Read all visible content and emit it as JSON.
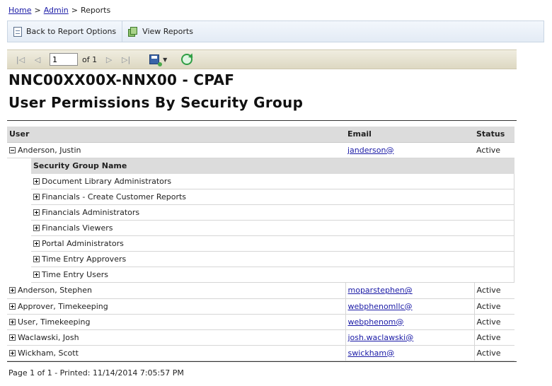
{
  "breadcrumb": {
    "home": "Home",
    "admin": "Admin",
    "current": "Reports",
    "separator": ">"
  },
  "actionbar": {
    "back_label": "Back to Report Options",
    "view_label": "View Reports"
  },
  "viewer_toolbar": {
    "page_value": "1",
    "of_label": "of 1"
  },
  "report": {
    "title": "NNC00XX00X-NNX00 - CPAF",
    "subtitle": "User Permissions By Security Group",
    "columns": {
      "user": "User",
      "email": "Email",
      "status": "Status"
    },
    "security_group_header": "Security Group Name",
    "users": [
      {
        "name": "Anderson, Justin",
        "email": "janderson@",
        "status": "Active",
        "expanded": true,
        "groups": [
          "Document Library Administrators",
          "Financials - Create Customer Reports",
          "Financials Administrators",
          "Financials Viewers",
          "Portal Administrators",
          "Time Entry Approvers",
          "Time Entry Users"
        ]
      },
      {
        "name": "Anderson, Stephen",
        "email": "moparstephen@",
        "status": "Active"
      },
      {
        "name": "Approver, Timekeeping",
        "email": "webphenomllc@",
        "status": "Active"
      },
      {
        "name": "User, Timekeeping",
        "email": "webphenom@",
        "status": "Active"
      },
      {
        "name": "Waclawski, Josh",
        "email": "josh.waclawski@",
        "status": "Active"
      },
      {
        "name": "Wickham, Scott",
        "email": "swickham@",
        "status": "Active"
      }
    ]
  },
  "footer": {
    "text": "Page 1 of 1 - Printed: 11/14/2014 7:05:57 PM"
  }
}
